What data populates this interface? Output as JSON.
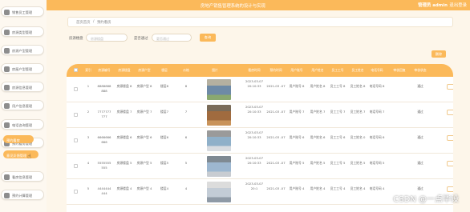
{
  "header": {
    "title": "房地产销售管理系统的设计与实现",
    "admin_label": "管理员 admin",
    "logout": "退出登录"
  },
  "sidebar": {
    "items": [
      {
        "label": "销售员工管理"
      },
      {
        "label": "房源类型管理"
      },
      {
        "label": "房源户型管理"
      },
      {
        "label": "房屋户型管理"
      },
      {
        "label": "房源信息管理"
      },
      {
        "label": "用户信息管理"
      },
      {
        "label": "电话咨询管理"
      },
      {
        "label": "预约看房管理"
      }
    ],
    "active_group": "预约看房",
    "sub_item": "意见反馈管理",
    "more_items": [
      {
        "label": "看房信息管理"
      },
      {
        "label": "预约计算管理"
      }
    ]
  },
  "breadcrumb": {
    "home": "首页首页",
    "sep": "/",
    "current": "预约看房"
  },
  "search": {
    "field1_label": "房源楼盘",
    "field1_placeholder": "房源楼盘",
    "field2_label": "是否通过",
    "field2_placeholder": "是否通过",
    "button": "查询"
  },
  "actions": {
    "delete_label": "删除"
  },
  "table": {
    "columns": [
      "索引",
      "房源编号",
      "房源楼盘",
      "房源户型",
      "楼层",
      "价格",
      "图片",
      "看房时间",
      "预约时间",
      "用户账号",
      "用户姓名",
      "员工工号",
      "员工姓名",
      "电话号码",
      "审核回复",
      "审核状态"
    ],
    "rows": [
      {
        "idx": "1",
        "no": "8888888 888",
        "estate": "房源楼盘 8",
        "type": "房源户型 8",
        "floor": "楼层8",
        "price": "8",
        "view_time": "2023-03-07 20:10:33",
        "order_time": "2021-03 -07",
        "account": "用户账号 8",
        "name": "用户姓名 8",
        "emp_no": "员工工号 8",
        "emp_name": "员工姓名 8",
        "phone": "电话号码 8",
        "reply": "",
        "status": "通过"
      },
      {
        "idx": "2",
        "no": "7777777 777",
        "estate": "房源楼盘 7",
        "type": "房源户型 7",
        "floor": "楼层7",
        "price": "7",
        "view_time": "2023-03-07 20:10:33",
        "order_time": "2021-03 -07",
        "account": "用户账号 7",
        "name": "用户姓名 7",
        "emp_no": "员工工号 7",
        "emp_name": "员工姓名 7",
        "phone": "电话号码 7",
        "reply": "",
        "status": "通过"
      },
      {
        "idx": "3",
        "no": "6666666 666",
        "estate": "房源楼盘 6",
        "type": "房源户型 6",
        "floor": "楼层6",
        "price": "6",
        "view_time": "2023-03-07 20:10:33",
        "order_time": "2021-03 -07",
        "account": "用户账号 6",
        "name": "用户姓名 6",
        "emp_no": "员工工号 6",
        "emp_name": "员工姓名 0",
        "phone": "电话号码 6",
        "reply": "",
        "status": "通过"
      },
      {
        "idx": "4",
        "no": "5555555 555",
        "estate": "房源楼盘 5",
        "type": "房源户型 5",
        "floor": "楼层5",
        "price": "5",
        "view_time": "2023-03-07 20:10:33",
        "order_time": "2021-03 -07",
        "account": "用户账号 5",
        "name": "用户姓名 5",
        "emp_no": "员工工号 5",
        "emp_name": "员工姓名 5",
        "phone": "电话号码 5",
        "reply": "",
        "status": "通过"
      },
      {
        "idx": "5",
        "no": "4444444 444",
        "estate": "房源楼盘 4",
        "type": "房源户型 4",
        "floor": "楼层4",
        "price": "4",
        "view_time": "2023-03-07 20:1",
        "order_time": "2021-03 -07",
        "account": "用户账号 4",
        "name": "用户姓名 4",
        "emp_no": "员工工号 4",
        "emp_name": "员工姓名 4",
        "phone": "电话号码 4",
        "reply": "",
        "status": "通过"
      }
    ]
  },
  "watermark": "CSDN @一点毕设",
  "colors": {
    "accent": "#fbb95a",
    "background": "#fdf6ea"
  }
}
